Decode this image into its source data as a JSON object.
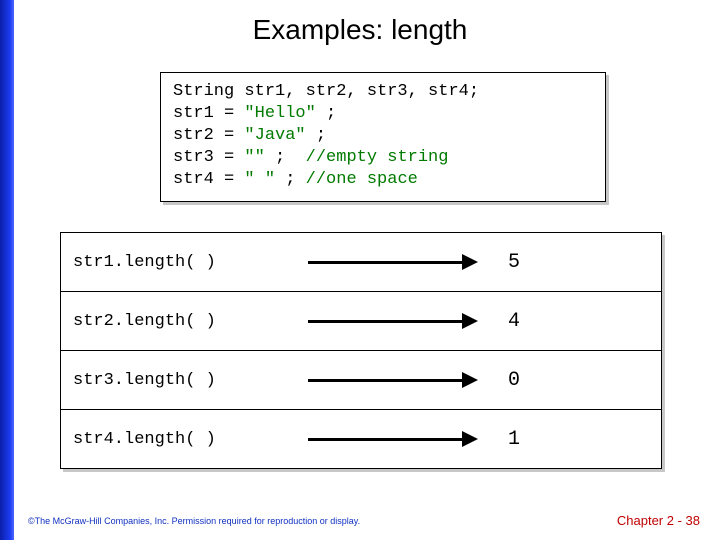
{
  "title": "Examples: length",
  "code": {
    "line1a": "String str1, str2, str3, str4;",
    "line2a": "str1 = ",
    "line2b": "\"Hello\" ",
    "line2c": ";",
    "line3a": "str2 = ",
    "line3b": "\"Java\" ",
    "line3c": ";",
    "line4a": "str3 = ",
    "line4b": "\"\" ",
    "line4c": ";  ",
    "line4d": "//empty string",
    "line5a": "str4 = ",
    "line5b": "\" \" ",
    "line5c": "; ",
    "line5d": "//one space"
  },
  "rows": [
    {
      "expr": "str1.length( )",
      "val": "5"
    },
    {
      "expr": "str2.length( )",
      "val": "4"
    },
    {
      "expr": "str3.length( )",
      "val": "0"
    },
    {
      "expr": "str4.length( )",
      "val": "1"
    }
  ],
  "footer": {
    "left": "©The McGraw-Hill Companies, Inc. Permission required for reproduction or display.",
    "right": "Chapter 2 - 38"
  }
}
